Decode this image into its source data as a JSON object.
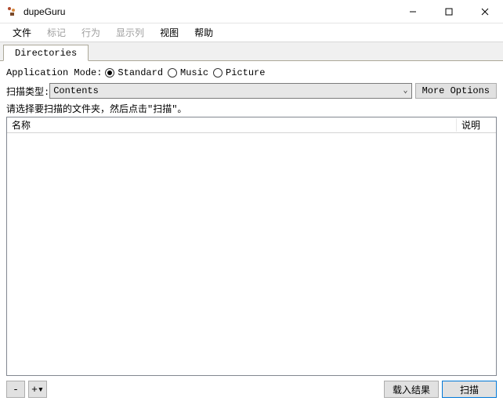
{
  "window": {
    "title": "dupeGuru"
  },
  "menu": {
    "file": "文件",
    "mark": "标记",
    "action": "行为",
    "columns": "显示列",
    "view": "视图",
    "help": "帮助"
  },
  "tabs": {
    "directories": "Directories"
  },
  "app_mode": {
    "label": "Application Mode:",
    "options": {
      "standard": "Standard",
      "music": "Music",
      "picture": "Picture"
    },
    "selected": "standard"
  },
  "scan_type": {
    "label": "扫描类型:",
    "value": "Contents",
    "more": "More Options"
  },
  "hint": "请选择要扫描的文件夹，然后点击\"扫描\"。",
  "list": {
    "col_name": "名称",
    "col_desc": "说明",
    "rows": []
  },
  "footer": {
    "remove": "-",
    "add": "+▾",
    "load_results": "载入结果",
    "scan": "扫描"
  }
}
